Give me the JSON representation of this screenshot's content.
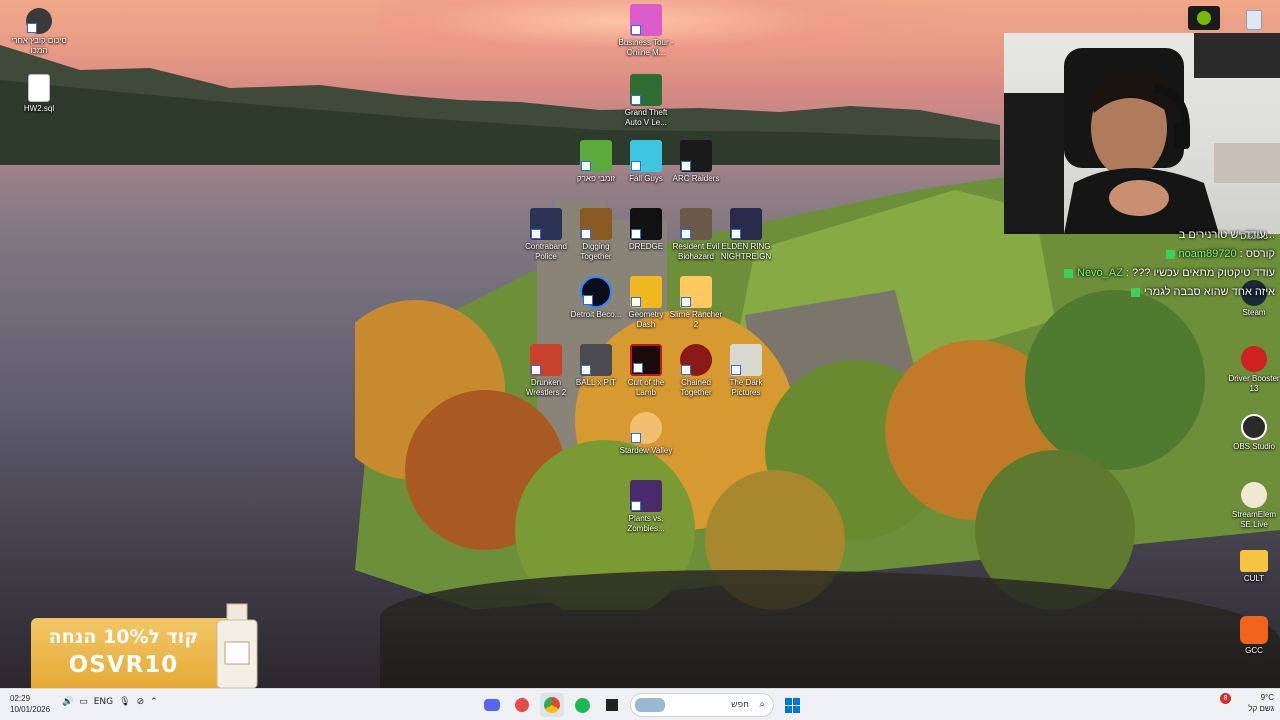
{
  "desktop_icons_left": [
    {
      "label": "סיכום קובץ אחר‏י המכו",
      "icon": "app-icon"
    },
    {
      "label": "HW2.sql",
      "icon": "file-icon"
    }
  ],
  "desktop_icons_center": [
    {
      "label": "Business Tour - Online M...",
      "icon": "business-tour-icon"
    },
    {
      "label": "Grand Theft Auto V Le...",
      "icon": "gta-icon"
    },
    {
      "label": "זומבי פארק",
      "icon": "zombie-icon"
    },
    {
      "label": "Fall Guys",
      "icon": "fall-guys-icon"
    },
    {
      "label": "ARC Raiders",
      "icon": "arc-raiders-icon"
    },
    {
      "label": "Contraband Police",
      "icon": "contraband-icon"
    },
    {
      "label": "Digging Together",
      "icon": "digging-icon"
    },
    {
      "label": "DREDGE",
      "icon": "dredge-icon"
    },
    {
      "label": "Resident Evil Biohazard",
      "icon": "resident-evil-icon"
    },
    {
      "label": "ELDEN RING NIGHTREIGN",
      "icon": "elden-ring-icon"
    },
    {
      "label": "Detroit Beco...",
      "icon": "detroit-icon"
    },
    {
      "label": "Geometry Dash",
      "icon": "geometry-dash-icon"
    },
    {
      "label": "Slime Rancher 2",
      "icon": "slime-rancher-icon"
    },
    {
      "label": "Drunken Wrestlers 2",
      "icon": "drunken-wrestlers-icon"
    },
    {
      "label": "BALL x PIT",
      "icon": "ball-pit-icon"
    },
    {
      "label": "Cult of the Lamb",
      "icon": "cult-lamb-icon"
    },
    {
      "label": "Chained Together",
      "icon": "chained-icon"
    },
    {
      "label": "The Dark Pictures",
      "icon": "dark-pictures-icon"
    },
    {
      "label": "Stardew Valley",
      "icon": "stardew-icon"
    },
    {
      "label": "Plants vs. Zombies...",
      "icon": "pvz-icon"
    }
  ],
  "desktop_icons_right": [
    {
      "label": "Discord",
      "icon": "discord-icon"
    },
    {
      "label": "Steam",
      "icon": "steam-icon"
    },
    {
      "label": "Driver Booster 13",
      "icon": "driver-booster-icon"
    },
    {
      "label": "OBS Studio",
      "icon": "obs-icon"
    },
    {
      "label": "StreamElem SE.Live",
      "icon": "streamelements-icon"
    },
    {
      "label": "CULT",
      "icon": "folder-icon"
    },
    {
      "label": "GCC",
      "icon": "gcc-icon"
    }
  ],
  "chat": [
    {
      "user": "",
      "message": "עודד יש טורנירים ב..."
    },
    {
      "user": "noam89720",
      "message": "קורסס"
    },
    {
      "user": "Nevo_AZ",
      "message": "??? עודד טיקטוק מתאים עכשיו"
    },
    {
      "user": "",
      "message": "איזה אחד שהוא סבבה לגמרי"
    }
  ],
  "promo": {
    "line1": "קוד ל10% הנחה",
    "line2": "OSVR10"
  },
  "taskbar": {
    "time": "02:29",
    "date": "10/01/2026",
    "language": "ENG",
    "search_placeholder": "חפש",
    "weather_temp": "9°C",
    "weather_text": "גשם קל",
    "notification_count": "8"
  },
  "colors": {
    "chat_user": "#7df07a",
    "taskbar_bg": "#eef0f4",
    "promo_bg": "#e6aa34"
  }
}
